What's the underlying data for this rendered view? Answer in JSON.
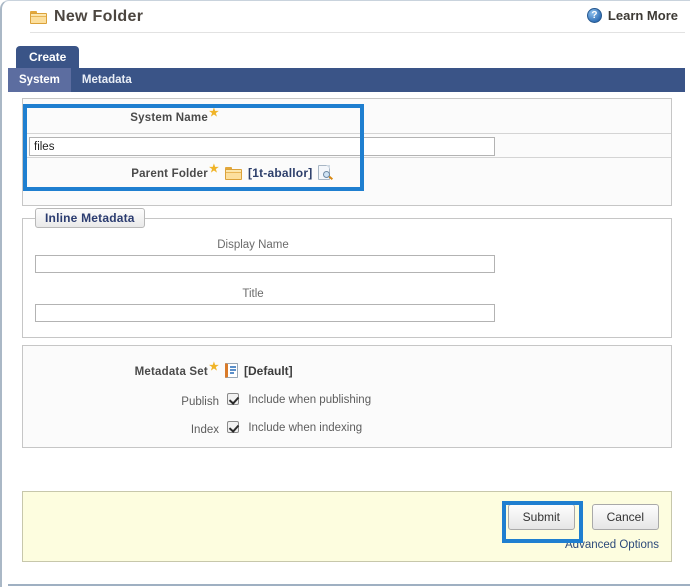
{
  "header": {
    "title": "New Folder",
    "folder_icon": "folder-icon",
    "learn_more": "Learn More",
    "help_icon": "question-mark-icon",
    "help_glyph": "?"
  },
  "tabs": {
    "primary": "Create",
    "secondary": [
      {
        "label": "System",
        "active": true
      },
      {
        "label": "Metadata",
        "active": false
      }
    ]
  },
  "system_section": {
    "system_name_label": "System Name",
    "system_name_value": "files",
    "system_name_placeholder": "",
    "parent_folder_label": "Parent Folder",
    "parent_folder_value": "[1t-aballor]",
    "parent_folder_icon": "folder-icon",
    "browse_icon": "page-search-icon",
    "required_marker": "★"
  },
  "inline_metadata": {
    "legend": "Inline Metadata",
    "fields": [
      {
        "label": "Display Name",
        "value": "",
        "placeholder": ""
      },
      {
        "label": "Title",
        "value": "",
        "placeholder": ""
      }
    ]
  },
  "metadata_set": {
    "label": "Metadata Set",
    "value": "[Default]",
    "set_icon": "document-icon",
    "options": [
      {
        "name": "Publish",
        "label": "Include when publishing",
        "checked": true
      },
      {
        "name": "Index",
        "label": "Include when indexing",
        "checked": true
      }
    ]
  },
  "actions": {
    "submit": "Submit",
    "cancel": "Cancel",
    "advanced_options": "Advanced Options"
  },
  "colors": {
    "tab_navy": "#3a5487",
    "tab_active": "#5c6da0",
    "highlight_blue": "#1f7fd0",
    "submit_panel_yellow": "#fdfddf",
    "required_star": "#f0b428",
    "link_navy": "#2d4a7a"
  }
}
